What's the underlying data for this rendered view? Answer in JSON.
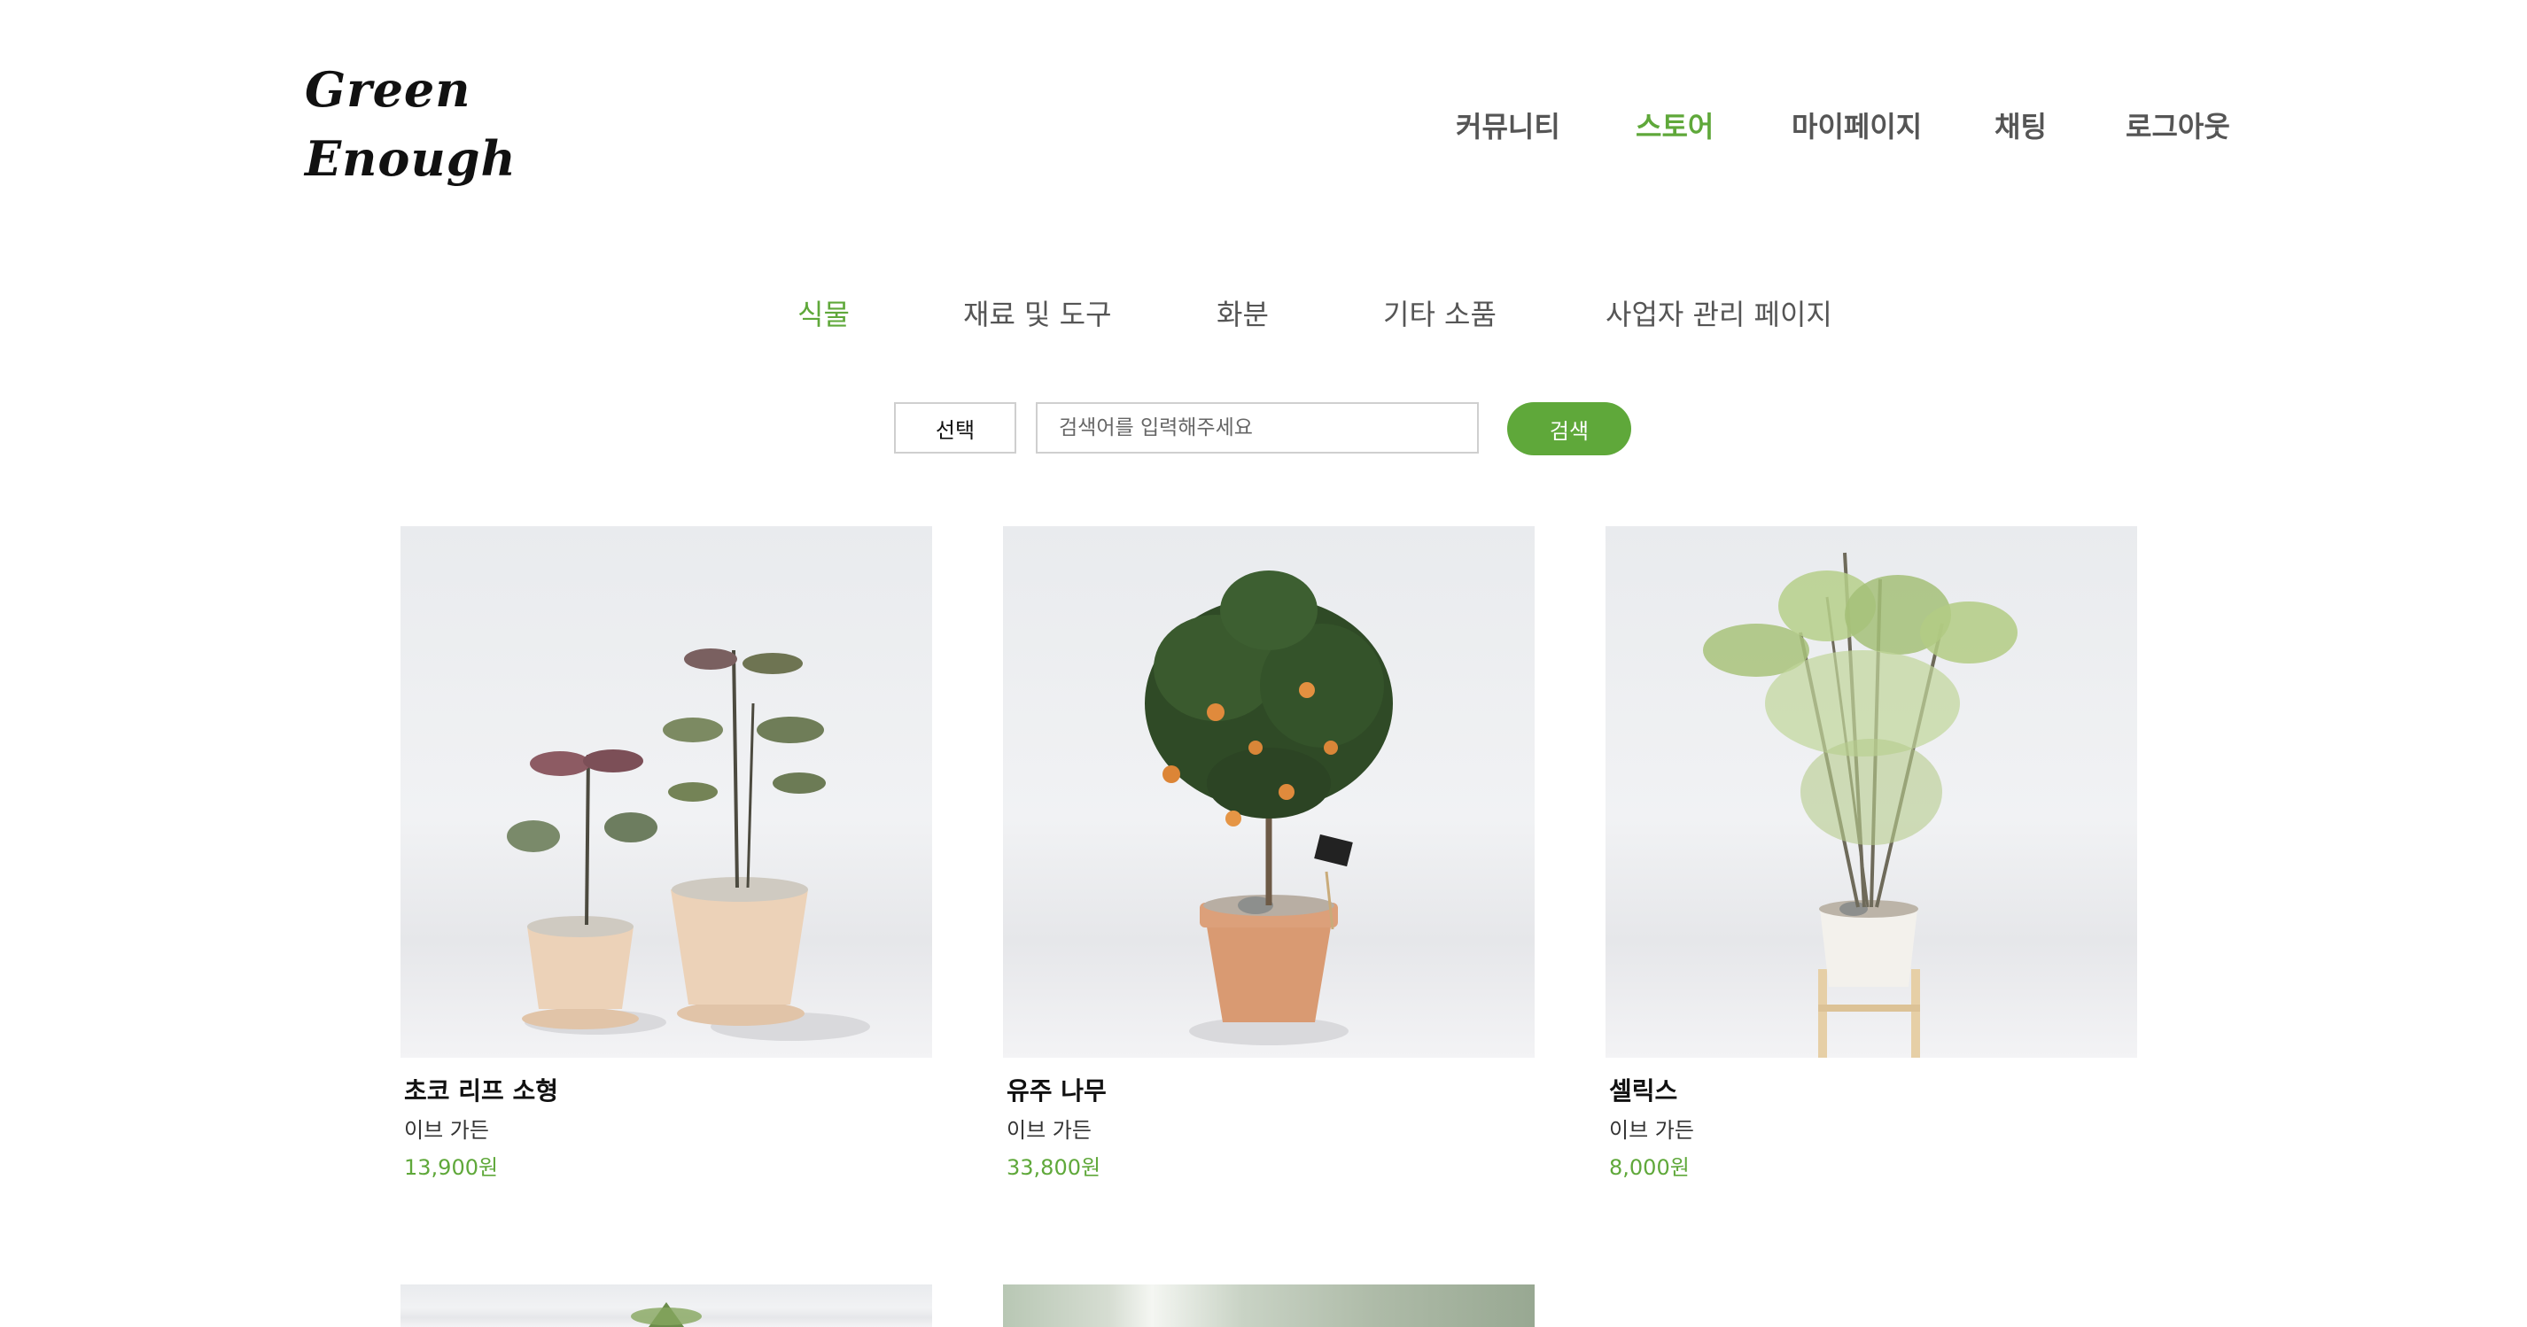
{
  "brand": {
    "line1": "Green",
    "line2": "Enough"
  },
  "top_nav": [
    "커뮤니티",
    "스토어",
    "마이페이지",
    "채팅",
    "로그아웃"
  ],
  "top_nav_active": "스토어",
  "sub_nav": [
    "식물",
    "재료 및 도구",
    "화분",
    "기타 소품",
    "사업자 관리 페이지"
  ],
  "sub_nav_active": "식물",
  "search": {
    "select_value": "선택",
    "placeholder": "검색어를 입력해주세요",
    "button_label": "검색"
  },
  "products": [
    {
      "name": "초코 리프 소형",
      "seller": "이브 가든",
      "price": "13,900원",
      "image": "two-small-potted-plants"
    },
    {
      "name": "유주 나무",
      "seller": "이브 가든",
      "price": "33,800원",
      "image": "potted-citrus-tree"
    },
    {
      "name": "셀릭스",
      "seller": "이브 가든",
      "price": "8,000원",
      "image": "salix-in-white-pot"
    }
  ],
  "colors": {
    "accent": "#5fa83a",
    "nav_text": "#555555",
    "border": "#cfcfcf"
  }
}
